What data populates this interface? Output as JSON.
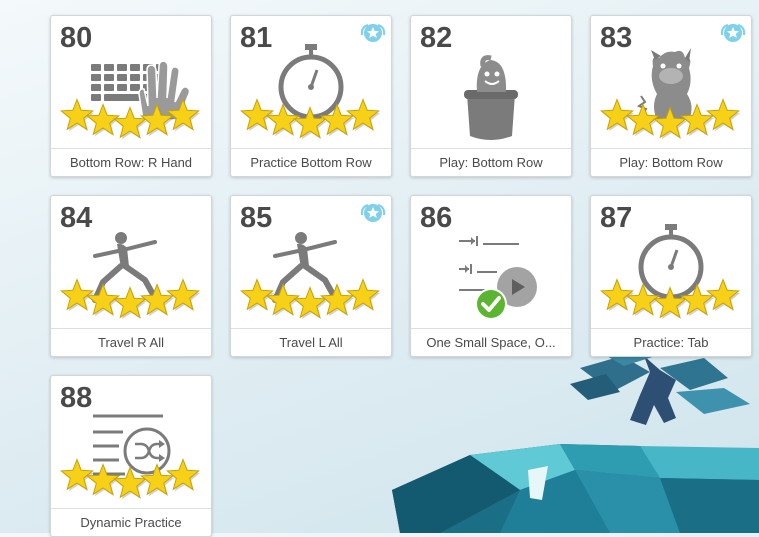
{
  "lessons": [
    {
      "number": "80",
      "title": "Bottom Row: R Hand",
      "icon": "keyboard-hand-icon",
      "stars": 5,
      "badge": false,
      "completed": false
    },
    {
      "number": "81",
      "title": "Practice Bottom Row",
      "icon": "stopwatch-icon",
      "stars": 5,
      "badge": true,
      "completed": false
    },
    {
      "number": "82",
      "title": "Play: Bottom Row",
      "icon": "game-creature-icon",
      "stars": 0,
      "badge": false,
      "completed": false
    },
    {
      "number": "83",
      "title": "Play: Bottom Row",
      "icon": "game-monster-icon",
      "stars": 5,
      "badge": true,
      "completed": false
    },
    {
      "number": "84",
      "title": "Travel R All",
      "icon": "yoga-lunge-icon",
      "stars": 5,
      "badge": false,
      "completed": false
    },
    {
      "number": "85",
      "title": "Travel L All",
      "icon": "yoga-lunge-icon",
      "stars": 5,
      "badge": true,
      "completed": false
    },
    {
      "number": "86",
      "title": "One Small Space, O...",
      "icon": "video-tabs-icon",
      "stars": 0,
      "badge": false,
      "completed": true
    },
    {
      "number": "87",
      "title": "Practice: Tab",
      "icon": "stopwatch-icon",
      "stars": 5,
      "badge": false,
      "completed": false
    },
    {
      "number": "88",
      "title": "Dynamic Practice",
      "icon": "shuffle-text-icon",
      "stars": 5,
      "badge": false,
      "completed": false
    }
  ],
  "colors": {
    "star_fill": "#f7d117",
    "icon_gray": "#7b7b7b",
    "check_green": "#5cb531",
    "badge_blue": "#7fd0ea"
  }
}
